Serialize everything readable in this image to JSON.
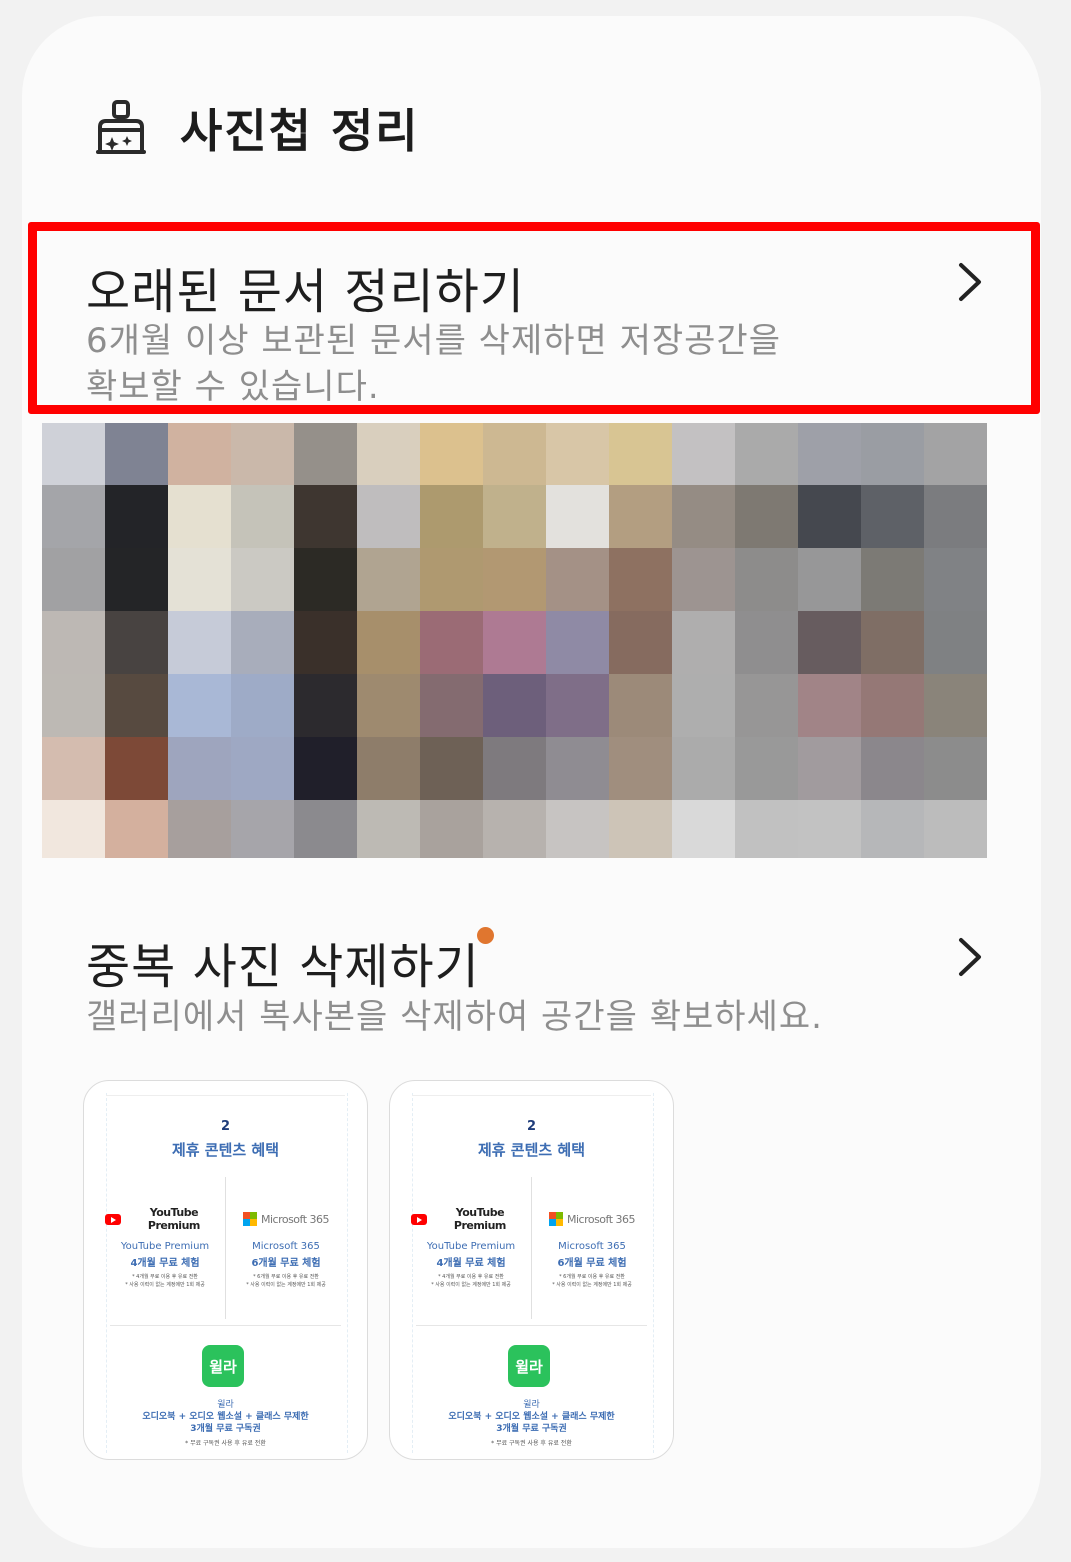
{
  "header": {
    "title": "사진첩 정리",
    "icon": "cleaning-brush-icon"
  },
  "old_documents": {
    "title": "오래된 문서 정리하기",
    "desc_line1": "6개월 이상 보관된 문서를 삭제하면 저장공간을",
    "desc_line2": "확보할 수 있습니다.",
    "chevron": "chevron-right-icon"
  },
  "duplicates": {
    "title": "중복 사진 삭제하기",
    "desc": "갤러리에서 복사본을 삭제하여 공간을 확보하세요.",
    "badge_color": "#e0762f",
    "chevron": "chevron-right-icon"
  },
  "thumbnail": {
    "number": "2",
    "heading": "제휴 콘텐츠 혜택",
    "youtube": {
      "brand": "YouTube Premium",
      "name": "YouTube Premium",
      "offer": "4개월 무료 체험",
      "note1": "* 4개월 무료 이용 후 유료 전환",
      "note2": "* 사용 이력이 없는 계정에만 1회 제공"
    },
    "microsoft": {
      "brand": "Microsoft 365",
      "name": "Microsoft 365",
      "offer": "6개월 무료 체험",
      "note1": "* 6개월 무료 이용 후 유료 전환",
      "note2": "* 사용 이력이 없는 계정에만 1회 제공"
    },
    "willa": {
      "logo": "윌라",
      "name": "윌라",
      "offer1": "오디오북 + 오디오 웹소설 + 클래스 무제한",
      "offer2": "3개월 무료 구독권",
      "note": "* 무료 구독권 사용 후 유료 전환"
    }
  },
  "mosaic_colors": [
    "#cfd1d8",
    "#7f8393",
    "#d0b2a0",
    "#cab8aa",
    "#95908a",
    "#d9cfbe",
    "#dcc18e",
    "#cdb892",
    "#d8c6a7",
    "#d8c593",
    "#c3c1c2",
    "#aaaaaa",
    "#9ea0a8",
    "#9a9da3",
    "#a3a3a4",
    "#a4a5a9",
    "#232428",
    "#e5e0d0",
    "#c5c3b9",
    "#3e3630",
    "#bfbdbe",
    "#ad9a6e",
    "#c0b18c",
    "#e3e1dd",
    "#b39e81",
    "#958c84",
    "#7e7972",
    "#45484f",
    "#5e6167",
    "#7b7c7f",
    "#a1a1a3",
    "#242527",
    "#e4e1d6",
    "#cbc9c3",
    "#2c2a25",
    "#b0a491",
    "#af9970",
    "#b29872",
    "#a49186",
    "#8e7161",
    "#9d9491",
    "#8d8c8b",
    "#979798",
    "#7c7a75",
    "#808285",
    "#bdb8b4",
    "#484341",
    "#c6cbd8",
    "#a8adbb",
    "#3a302a",
    "#a78f6b",
    "#9b6b75",
    "#ae7a93",
    "#8f8aa5",
    "#866b5f",
    "#afaeae",
    "#8f8e8f",
    "#675c5f",
    "#7f6e65",
    "#7f8183",
    "#bdb9b4",
    "#574a40",
    "#a9b8d6",
    "#9eabc7",
    "#2c2a2e",
    "#9e8a6f",
    "#846b70",
    "#6d5f7b",
    "#7f6e88",
    "#9c8a79",
    "#aeaeae",
    "#979696",
    "#a18487",
    "#957876",
    "#8a847a",
    "#d4bcaf",
    "#7d4937",
    "#9ea5be",
    "#9ea8c3",
    "#201f2a",
    "#8e7d6a",
    "#6e6156",
    "#7e7a7e",
    "#8f8c92",
    "#a08e7e",
    "#ababab",
    "#999999",
    "#a19b9e",
    "#8b878c",
    "#8c8c8c",
    "#f1e7de",
    "#d4b09e",
    "#a79f9d",
    "#a6a5aa",
    "#8b8a8e",
    "#bdbab4",
    "#a9a29d",
    "#b7b2ae",
    "#c7c4c2",
    "#cdc4b7",
    "#d9d9d9",
    "#c1c1c1",
    "#c2c2c2",
    "#b6b7b9",
    "#bcbcbc"
  ]
}
